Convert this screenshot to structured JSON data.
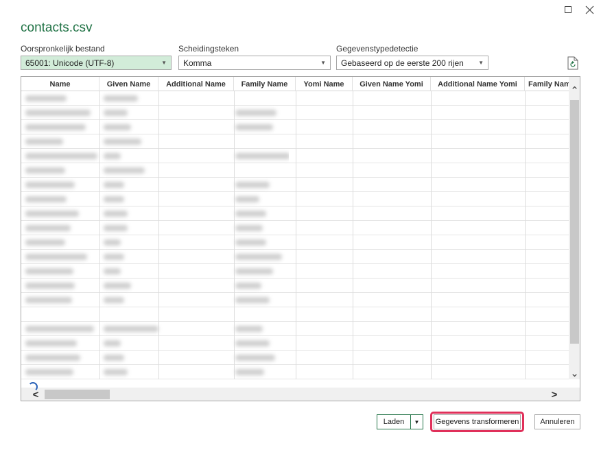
{
  "window": {
    "maximize_icon": "maximize-icon",
    "close_icon": "close-icon"
  },
  "dialog": {
    "title": "contacts.csv",
    "source_label": "Oorspronkelijk bestand",
    "source_value": "65001: Unicode (UTF-8)",
    "delimiter_label": "Scheidingsteken",
    "delimiter_value": "Komma",
    "detection_label": "Gegevenstypedetectie",
    "detection_value": "Gebaseerd op de eerste 200 rijen"
  },
  "table": {
    "columns": [
      "Name",
      "Given Name",
      "Additional Name",
      "Family Name",
      "Yomi Name",
      "Given Name Yomi",
      "Additional Name Yomi",
      "Family Nam"
    ]
  },
  "buttons": {
    "load": "Laden",
    "transform": "Gegevens transformeren",
    "cancel": "Annuleren"
  },
  "colors": {
    "accent": "#217346",
    "highlight": "#e0305a",
    "selected_bg": "#d2ecd9"
  }
}
